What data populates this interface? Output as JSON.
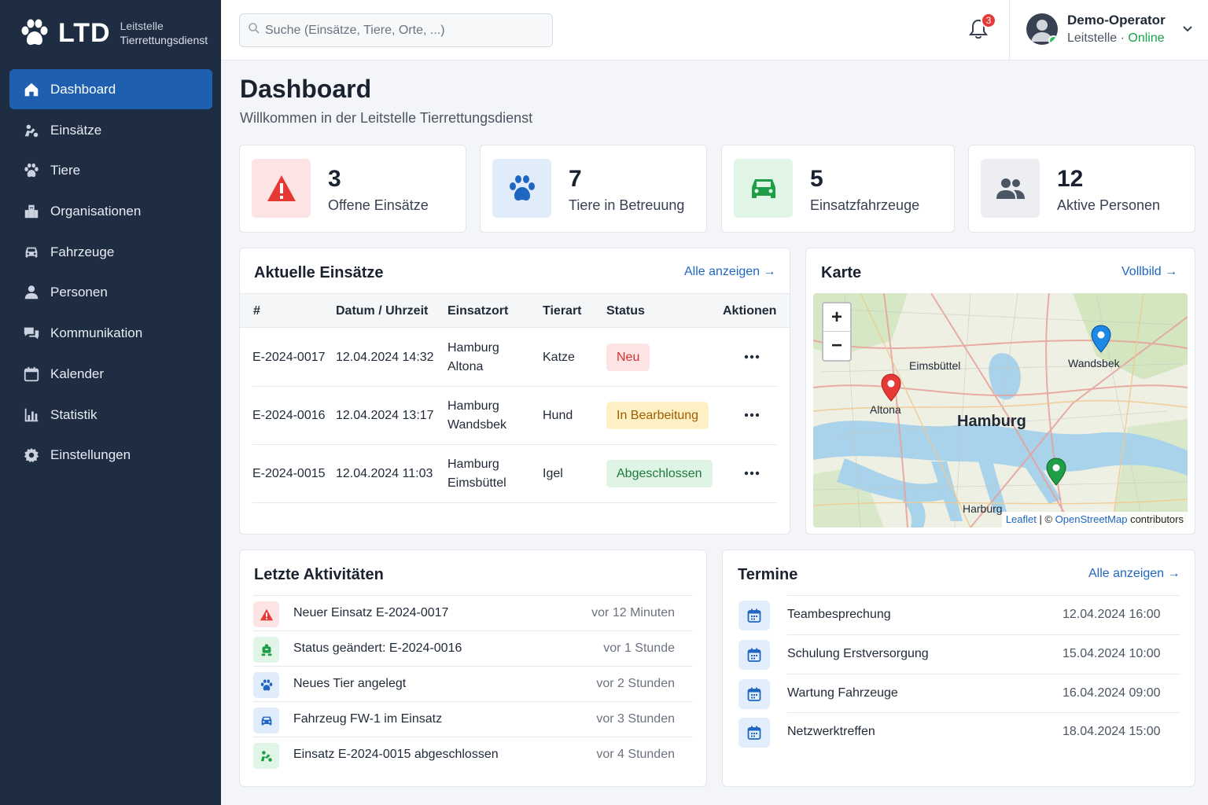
{
  "brand": {
    "name": "LTD",
    "line1": "Leitstelle",
    "line2": "Tierrettungsdienst"
  },
  "nav": [
    {
      "label": "Dashboard",
      "icon": "home-icon",
      "active": true
    },
    {
      "label": "Einsätze",
      "icon": "rescue-icon"
    },
    {
      "label": "Tiere",
      "icon": "paw-icon"
    },
    {
      "label": "Organisationen",
      "icon": "organization-icon"
    },
    {
      "label": "Fahrzeuge",
      "icon": "car-icon"
    },
    {
      "label": "Personen",
      "icon": "person-icon"
    },
    {
      "label": "Kommunikation",
      "icon": "chat-icon"
    },
    {
      "label": "Kalender",
      "icon": "calendar-icon"
    },
    {
      "label": "Statistik",
      "icon": "chart-icon"
    },
    {
      "label": "Einstellungen",
      "icon": "gear-icon"
    }
  ],
  "search": {
    "placeholder": "Suche (Einsätze, Tiere, Orte, ...)"
  },
  "notifications": {
    "count": "3"
  },
  "user": {
    "name": "Demo-Operator",
    "role": "Leitstelle",
    "separator": " · ",
    "status": "Online"
  },
  "page": {
    "title": "Dashboard",
    "subtitle": "Willkommen in der Leitstelle Tierrettungsdienst"
  },
  "stats": [
    {
      "value": "3",
      "label": "Offene Einsätze",
      "icon": "warning-icon",
      "color": "#e53935",
      "bg": "#fde4e4"
    },
    {
      "value": "7",
      "label": "Tiere in Betreuung",
      "icon": "paw-icon",
      "color": "#1f66c2",
      "bg": "#e1ecfb"
    },
    {
      "value": "5",
      "label": "Einsatzfahrzeuge",
      "icon": "car-icon",
      "color": "#1f9d47",
      "bg": "#e0f5e6"
    },
    {
      "value": "12",
      "label": "Aktive Personen",
      "icon": "people-icon",
      "color": "#4b5563",
      "bg": "#eceef1"
    }
  ],
  "missions": {
    "title": "Aktuelle Einsätze",
    "link": "Alle anzeigen →",
    "columns": [
      "#",
      "Datum / Uhrzeit",
      "Einsatzort",
      "Tierart",
      "Status",
      "Aktionen"
    ],
    "rows": [
      {
        "id": "E-2024-0017",
        "datetime": "12.04.2024 14:32",
        "place1": "Hamburg",
        "place2": "Altona",
        "animal": "Katze",
        "status": "Neu",
        "status_color": "#d32f2f",
        "status_bg": "#fde4e4"
      },
      {
        "id": "E-2024-0016",
        "datetime": "12.04.2024 13:17",
        "place1": "Hamburg",
        "place2": "Wandsbek",
        "animal": "Hund",
        "status": "In Bearbeitung",
        "status_color": "#a15c00",
        "status_bg": "#fdf0c4"
      },
      {
        "id": "E-2024-0015",
        "datetime": "12.04.2024 11:03",
        "place1": "Hamburg",
        "place2": "Eimsbüttel",
        "animal": "Igel",
        "status": "Abgeschlossen",
        "status_color": "#1b7a3a",
        "status_bg": "#dff4e5"
      }
    ]
  },
  "map": {
    "title": "Karte",
    "link": "Vollbild →",
    "zoom_in": "+",
    "zoom_out": "−",
    "labels": {
      "eimsbuettel": "Eimsbüttel",
      "wandsbek": "Wandsbek",
      "altona": "Altona",
      "hamburg": "Hamburg",
      "harburg": "Harburg"
    },
    "attribution": {
      "leaflet": "Leaflet",
      "sep": " | © ",
      "osm": "OpenStreetMap",
      "contrib": " contributors"
    },
    "pin_colors": {
      "altona": "#e53935",
      "wandsbek": "#1e88e5",
      "south": "#1f9d47"
    }
  },
  "activities": {
    "title": "Letzte Aktivitäten",
    "items": [
      {
        "text": "Neuer Einsatz E-2024-0017",
        "time": "vor 12 Minuten",
        "icon": "warning-icon",
        "color": "#e53935",
        "bg": "#fde4e4"
      },
      {
        "text": "Status geändert: E-2024-0016",
        "time": "vor 1 Stunde",
        "icon": "rescue-icon",
        "color": "#1f9d47",
        "bg": "#e0f5e6"
      },
      {
        "text": "Neues Tier angelegt",
        "time": "vor 2 Stunden",
        "icon": "paw-icon",
        "color": "#1f66c2",
        "bg": "#e1ecfb"
      },
      {
        "text": "Fahrzeug FW-1 im Einsatz",
        "time": "vor 3 Stunden",
        "icon": "car-icon",
        "color": "#1f66c2",
        "bg": "#e1ecfb"
      },
      {
        "text": "Einsatz E-2024-0015 abgeschlossen",
        "time": "vor 4 Stunden",
        "icon": "rescue-icon",
        "color": "#1f9d47",
        "bg": "#e0f5e6"
      }
    ]
  },
  "appointments": {
    "title": "Termine",
    "link": "Alle anzeigen →",
    "items": [
      {
        "text": "Teambesprechung",
        "date": "12.04.2024 16:00"
      },
      {
        "text": "Schulung Erstversorgung",
        "date": "15.04.2024 10:00"
      },
      {
        "text": "Wartung Fahrzeuge",
        "date": "16.04.2024 09:00"
      },
      {
        "text": "Netzwerktreffen",
        "date": "18.04.2024 15:00"
      }
    ]
  }
}
